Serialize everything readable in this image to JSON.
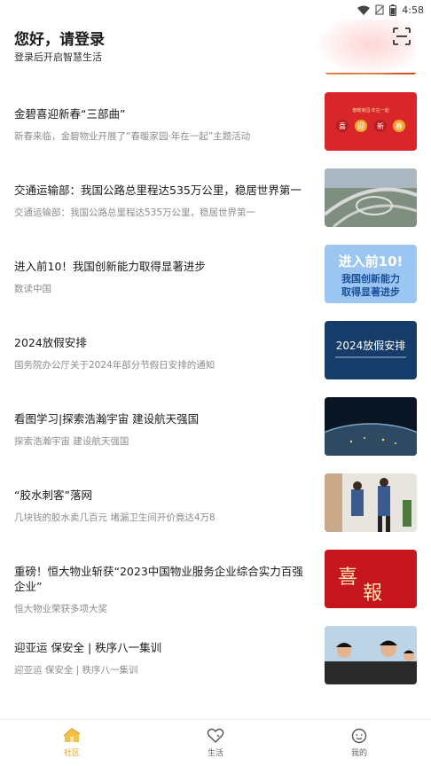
{
  "status_bar": {
    "time": "4:58"
  },
  "header": {
    "title": "您好，请登录",
    "subtitle": "登录后开启智慧生活"
  },
  "news": [
    {
      "headline": "金碧喜迎新春“三部曲”",
      "desc": "新春来临，金碧物业开展了“春暖家园·年在一起”主题活动",
      "thumb_text": [
        "喜",
        "迎",
        "新",
        "春"
      ],
      "thumb_caption": "春暖家园·年在一起"
    },
    {
      "headline": "交通运输部：我国公路总里程达535万公里，稳居世界第一",
      "desc": "交通运输部：我国公路总里程达535万公里，稳居世界第一"
    },
    {
      "headline": "进入前10！我国创新能力取得显著进步",
      "desc": "数读中国",
      "thumb_text": [
        "进入前10!",
        "我国创新能力",
        "取得显著进步"
      ]
    },
    {
      "headline": "2024放假安排",
      "desc": "国务院办公厅关于2024年部分节假日安排的通知",
      "thumb_text": [
        "2024放假安排"
      ]
    },
    {
      "headline": "看图学习|探索浩瀚宇宙 建设航天强国",
      "desc": "探索浩瀚宇宙 建设航天强国"
    },
    {
      "headline": "“胶水刺客”落网",
      "desc": "几块钱的胶水卖几百元 堵漏卫生间开价竟达4万8"
    },
    {
      "headline": "重磅！恒大物业斩获“2023中国物业服务企业综合实力百强企业”",
      "desc": "恒大物业荣获多项大奖",
      "thumb_text": [
        "喜",
        "報"
      ]
    },
    {
      "headline": "迎亚运  保安全 | 秩序八一集训",
      "desc": "迎亚运  保安全 | 秩序八一集训"
    }
  ],
  "tabbar": {
    "items": [
      {
        "label": "社区",
        "icon": "community-icon",
        "active": true
      },
      {
        "label": "生活",
        "icon": "life-heart-icon",
        "active": false
      },
      {
        "label": "我的",
        "icon": "profile-face-icon",
        "active": false
      }
    ],
    "active_color": "#e5a321"
  }
}
